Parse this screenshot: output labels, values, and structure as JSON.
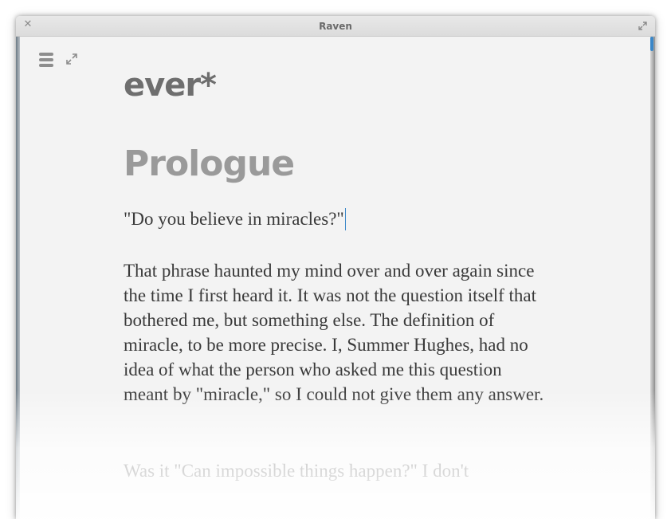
{
  "window": {
    "title": "Raven",
    "close_icon": "close-icon",
    "maximize_icon": "maximize-icon"
  },
  "toolbar": {
    "menu_icon": "hamburger-menu-icon",
    "fullscreen_icon": "fullscreen-icon"
  },
  "document": {
    "title": "ever*",
    "chapter": "Prologue",
    "paragraphs": [
      "\"Do you believe in miracles?\"",
      "That phrase haunted my mind over and over again since the time I first heard it. It was not the question itself that bothered me, but something else. The definition of miracle, to be more precise. I, Summer Hughes, had no idea of what the person who asked me this question meant by \"miracle,\" so I could not give them any answer.",
      "Was it \"Can impossible things happen?\" I don't"
    ]
  },
  "colors": {
    "accent": "#3a87c8",
    "title": "#6e6e6e",
    "chapter": "#9a9a9a",
    "body": "#3a3a3a",
    "background": "#f3f3f3"
  }
}
